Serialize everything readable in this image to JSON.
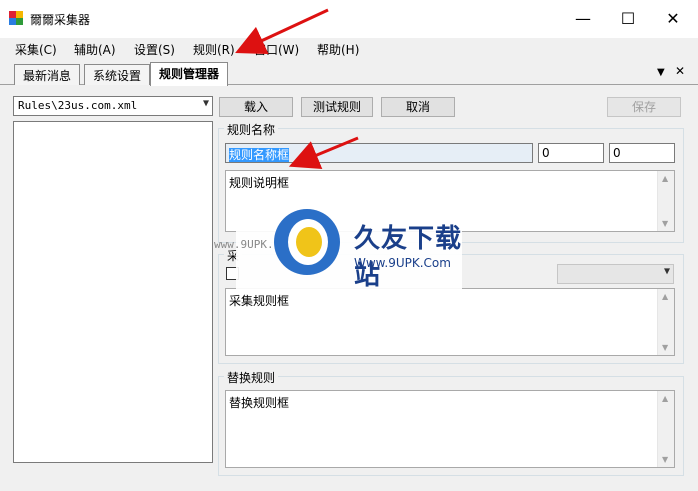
{
  "window": {
    "title": "爾爾采集器",
    "min": "—",
    "max": "☐",
    "close": "✕"
  },
  "menu": [
    {
      "label": "采集(C)"
    },
    {
      "label": "辅助(A)"
    },
    {
      "label": "设置(S)"
    },
    {
      "label": "规则(R)"
    },
    {
      "label": "窗口(W)"
    },
    {
      "label": "帮助(H)"
    }
  ],
  "tabs": [
    {
      "label": "最新消息"
    },
    {
      "label": "系统设置"
    },
    {
      "label": "规则管理器"
    }
  ],
  "tab_tools": {
    "dropdown": "▼",
    "close": "✕"
  },
  "rule_file": {
    "value": "Rules\\23us.com.xml"
  },
  "buttons": {
    "load": "载入",
    "test": "测试规则",
    "cancel": "取消",
    "save": "保存"
  },
  "rule_name": {
    "group_label": "规则名称",
    "name_value": "规则名称框",
    "field2": "0",
    "field3": "0",
    "description": "规则说明框"
  },
  "collect": {
    "group_label": "采",
    "rules_text": "采集规则框"
  },
  "replace": {
    "group_label": "替换规则",
    "rules_text": "替换规则框"
  },
  "watermark": {
    "title": "久友下载站",
    "url": "Www.9UPK.Com",
    "left_text": "www.9UPK.com"
  },
  "colors": {
    "accent": "#cc0000",
    "selection": "#3399ff"
  }
}
